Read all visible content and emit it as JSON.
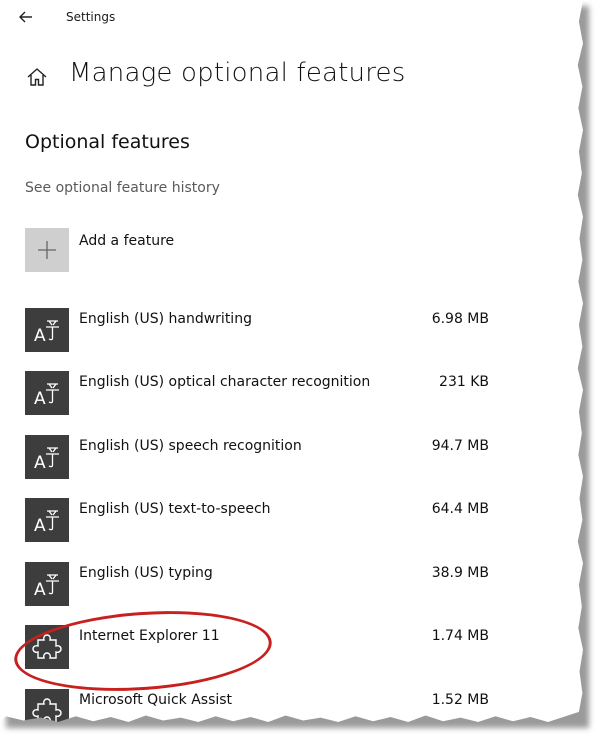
{
  "window": {
    "title": "Settings",
    "back_icon": "back-arrow-icon"
  },
  "header": {
    "home_icon": "home-icon",
    "title": "Manage optional features"
  },
  "section": {
    "title": "Optional features",
    "history_link": "See optional feature history"
  },
  "add_feature": {
    "label": "Add a feature",
    "icon": "plus-icon"
  },
  "features": [
    {
      "name": "English (US) handwriting",
      "size": "6.98 MB",
      "icon": "language-icon"
    },
    {
      "name": "English (US) optical character recognition",
      "size": "231 KB",
      "icon": "language-icon"
    },
    {
      "name": "English (US) speech recognition",
      "size": "94.7 MB",
      "icon": "language-icon"
    },
    {
      "name": "English (US) text-to-speech",
      "size": "64.4 MB",
      "icon": "language-icon"
    },
    {
      "name": "English (US) typing",
      "size": "38.9 MB",
      "icon": "language-icon"
    },
    {
      "name": "Internet Explorer 11",
      "size": "1.74 MB",
      "icon": "puzzle-icon"
    },
    {
      "name": "Microsoft Quick Assist",
      "size": "1.52 MB",
      "icon": "puzzle-icon"
    }
  ],
  "colors": {
    "annotation": "#c8201e",
    "feature_tile": "#3d3d3d",
    "add_tile": "#cfcfcf"
  }
}
